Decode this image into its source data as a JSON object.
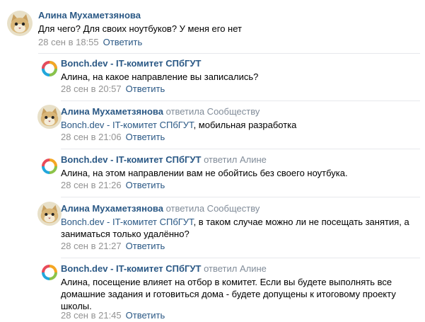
{
  "comments": [
    {
      "author": "Алина Мухаметзянова",
      "replied_to": "",
      "mention": "",
      "text": "Для чего? Для своих ноутбуков? У меня его нет",
      "time": "28 сен в 18:55",
      "reply_label": "Ответить"
    },
    {
      "author": "Bonch.dev - IT-комитет СПбГУТ",
      "replied_to": "",
      "mention": "",
      "text": "Алина, на какое направление вы записались?",
      "time": "28 сен в 20:57",
      "reply_label": "Ответить"
    },
    {
      "author": "Алина Мухаметзянова",
      "replied_to": "ответила Сообществу",
      "mention": "Bonch.dev - IT-комитет СПбГУТ",
      "text": ", мобильная разработка",
      "time": "28 сен в 21:06",
      "reply_label": "Ответить"
    },
    {
      "author": "Bonch.dev - IT-комитет СПбГУТ",
      "replied_to": "ответил Алине",
      "mention": "",
      "text": "Алина, на этом направлении вам не обойтись без своего ноутбука.",
      "time": "28 сен в 21:26",
      "reply_label": "Ответить"
    },
    {
      "author": "Алина Мухаметзянова",
      "replied_to": "ответила Сообществу",
      "mention": "Bonch.dev - IT-комитет СПбГУТ",
      "text": ", в таком случае можно ли не посещать занятия, а заниматься только удалённо?",
      "time": "28 сен в 21:27",
      "reply_label": "Ответить"
    },
    {
      "author": "Bonch.dev - IT-комитет СПбГУТ",
      "replied_to": "ответил Алине",
      "mention": "",
      "text": "Алина, посещение влияет на отбор в комитет. Если вы будете выполнять все домашние задания и готовиться дома - будете допущены к итоговому проекту школы.",
      "time": "28 сен в 21:45",
      "reply_label": "Ответить"
    }
  ]
}
